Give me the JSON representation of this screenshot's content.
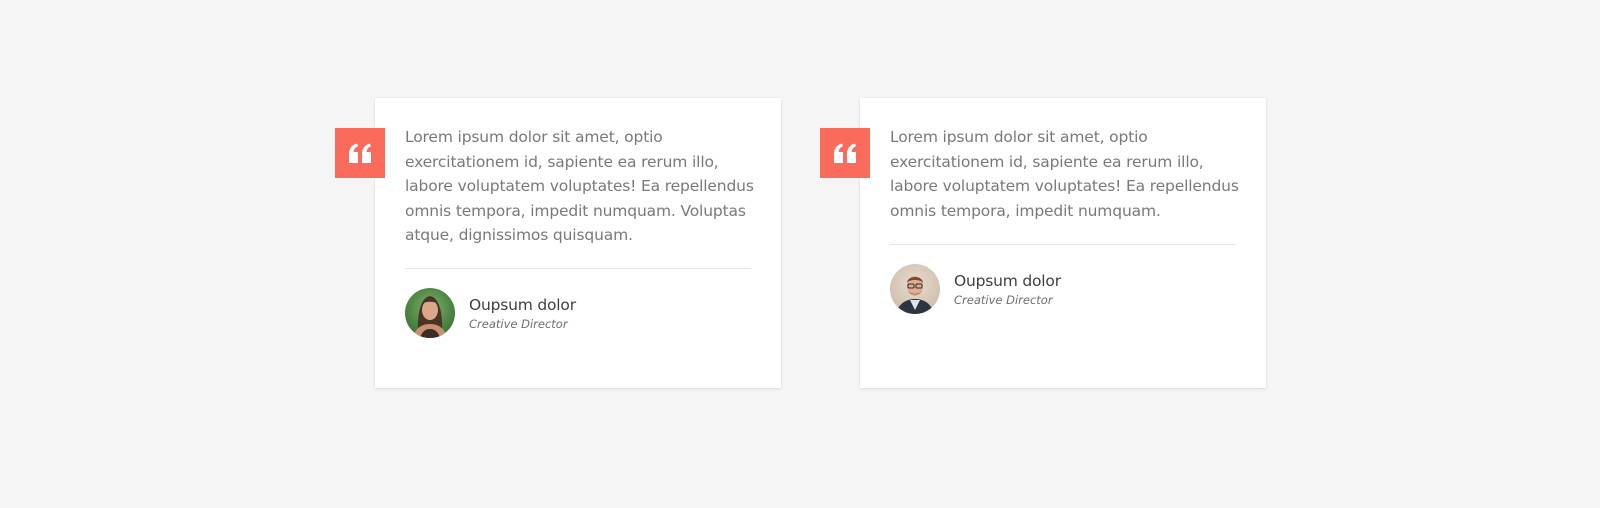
{
  "colors": {
    "background": "#f4f5f4",
    "card": "#ffffff",
    "accent": "#fb6b5b",
    "body_text": "#77797b",
    "name_text": "#3c3f42",
    "divider": "#e6e7e8"
  },
  "testimonials": [
    {
      "icon": "quote-icon",
      "quote": "Lorem ipsum dolor sit amet, optio exercitationem id, sapiente ea rerum illo, labore voluptatem voluptates! Ea repellendus omnis tempora, impedit numquam. Voluptas atque, dignissimos quisquam.",
      "author_name": "Oupsum dolor",
      "author_role": "Creative Director",
      "avatar": "avatar-woman"
    },
    {
      "icon": "quote-icon",
      "quote": "Lorem ipsum dolor sit amet, optio exercitationem id, sapiente ea rerum illo, labore voluptatem voluptates! Ea repellendus omnis tempora, impedit numquam.",
      "author_name": "Oupsum dolor",
      "author_role": "Creative Director",
      "avatar": "avatar-man"
    }
  ]
}
